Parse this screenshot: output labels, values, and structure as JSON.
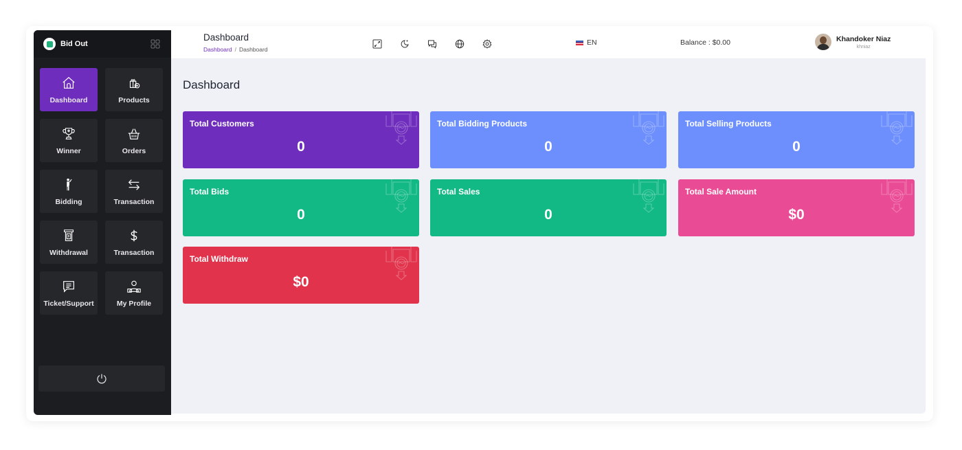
{
  "brand": {
    "name": "Bid Out"
  },
  "sidebar": {
    "items": [
      {
        "label": "Dashboard",
        "icon": "home-icon",
        "active": true
      },
      {
        "label": "Products",
        "icon": "products-icon",
        "active": false
      },
      {
        "label": "Winner",
        "icon": "trophy-icon",
        "active": false
      },
      {
        "label": "Orders",
        "icon": "basket-icon",
        "active": false
      },
      {
        "label": "Bidding",
        "icon": "bidder-icon",
        "active": false
      },
      {
        "label": "Transaction",
        "icon": "swap-arrows-icon",
        "active": false
      },
      {
        "label": "Withdrawal",
        "icon": "atm-icon",
        "active": false
      },
      {
        "label": "Transaction",
        "icon": "dollar-icon",
        "active": false
      },
      {
        "label": "Ticket/Support",
        "icon": "message-icon",
        "active": false
      },
      {
        "label": "My Profile",
        "icon": "profile-icon",
        "active": false
      }
    ]
  },
  "topbar": {
    "title": "Dashboard",
    "breadcrumb": [
      "Dashboard",
      "Dashboard"
    ],
    "breadcrumb_separator": "/",
    "icons": [
      "fullscreen-icon",
      "dark-mode-icon",
      "chat-icon",
      "globe-icon",
      "settings-icon"
    ],
    "language": "EN",
    "balance": "Balance : $0.00",
    "user": {
      "name": "Khandoker Niaz",
      "handle": "khniaz"
    }
  },
  "main": {
    "title": "Dashboard",
    "cards": [
      {
        "title": "Total Customers",
        "value": "0",
        "color": "#6f2dbd"
      },
      {
        "title": "Total Bidding Products",
        "value": "0",
        "color": "#6d8ffd"
      },
      {
        "title": "Total Selling Products",
        "value": "0",
        "color": "#6d8ffd"
      },
      {
        "title": "Total Bids",
        "value": "0",
        "color": "#13b985"
      },
      {
        "title": "Total Sales",
        "value": "0",
        "color": "#13b985"
      },
      {
        "title": "Total Sale Amount",
        "value": "$0",
        "color": "#ea4b95"
      },
      {
        "title": "Total Withdraw",
        "value": "$0",
        "color": "#e1334b"
      }
    ]
  },
  "colors": {
    "accent": "#6f2dbd",
    "sidebar_bg": "#1c1d21",
    "sidebar_item_bg": "#26272b",
    "main_bg": "#f0f1f7"
  }
}
